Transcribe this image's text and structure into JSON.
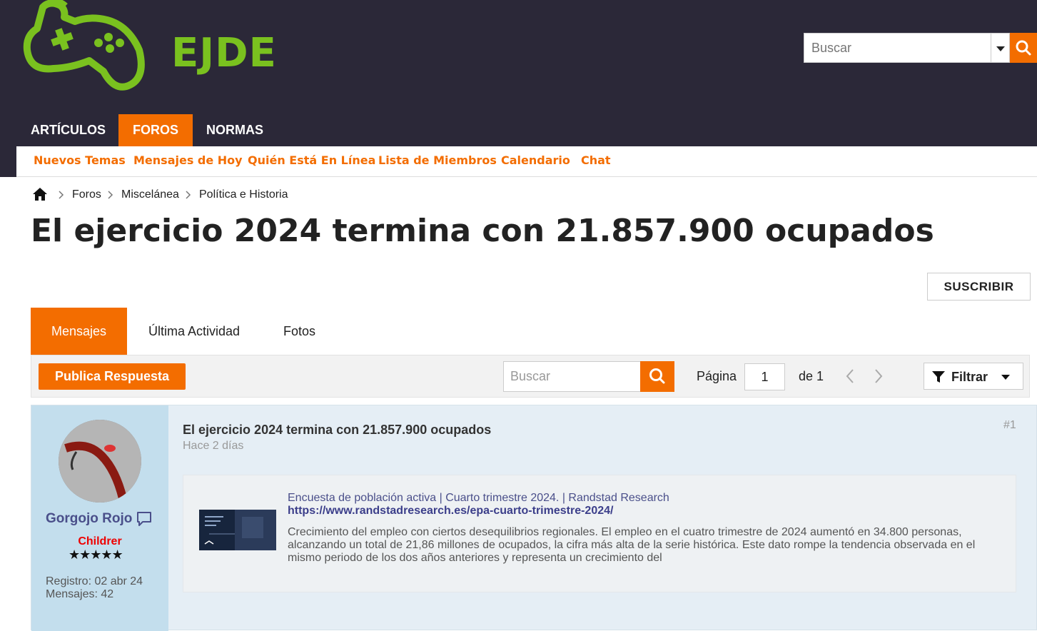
{
  "brand": {
    "logo_text": "EJDE",
    "accent": "#f36d00",
    "logo_color": "#7ac11f",
    "header_bg": "#2b2838"
  },
  "header_search": {
    "placeholder": "Buscar"
  },
  "nav": {
    "tabs": [
      "ARTÍCULOS",
      "FOROS",
      "NORMAS"
    ],
    "active": "FOROS"
  },
  "subnav": [
    "Nuevos Temas",
    "Mensajes de Hoy",
    "Quién Está En Línea",
    "Lista de Miembros",
    "Calendario",
    "Chat"
  ],
  "breadcrumb": [
    "Foros",
    "Miscelánea",
    "Política e Historia"
  ],
  "thread": {
    "title": "El ejercicio 2024 termina con 21.857.900 ocupados",
    "subscribe_label": "SUSCRIBIR"
  },
  "tabs": [
    "Mensajes",
    "Última Actividad",
    "Fotos"
  ],
  "toolbar": {
    "reply_label": "Publica Respuesta",
    "search_placeholder": "Buscar",
    "page_label": "Página",
    "page_value": "1",
    "page_of": "de  1",
    "filter_label": "Filtrar"
  },
  "post": {
    "author": "Gorgojo Rojo",
    "rank": "Childrer",
    "stars": "★★★★★",
    "registered": "Registro: 02 abr 24",
    "messages": "Mensajes: 42",
    "title": "El ejercicio 2024 termina con 21.857.900 ocupados",
    "date": "Hace 2 días",
    "number": "#1",
    "preview": {
      "title": "Encuesta de población activa | Cuarto trimestre 2024. | Randstad Research",
      "url": "https://www.randstadresearch.es/epa-cuarto-trimestre-2024/",
      "description": "Crecimiento del empleo con ciertos desequilibrios regionales. El empleo en el cuatro trimestre de 2024 aumentó en 34.800 personas, alcanzando un total de 21,86 millones de ocupados, la cifra más alta de la serie histórica. Este dato rompe la tendencia observada en el mismo periodo de los dos años anteriores y representa un crecimiento del"
    }
  }
}
